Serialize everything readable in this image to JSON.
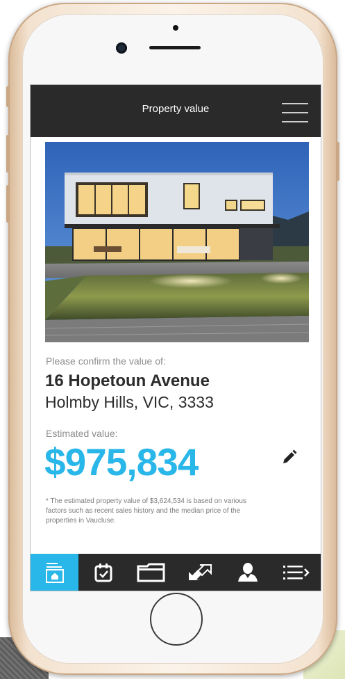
{
  "header": {
    "title": "Property value",
    "menu_icon": "hamburger-icon"
  },
  "property": {
    "confirm_label": "Please confirm the value of:",
    "street": "16 Hopetoun Avenue",
    "suburb_line": "Holmby Hills, VIC, 3333",
    "estimated_label": "Estimated value:",
    "estimated_value": "$975,834",
    "disclaimer": "* The estimated property value of $3,624,534 is based on various factors such as recent sales history and the median price of the properties in Vaucluse."
  },
  "bottom_nav": {
    "items": [
      {
        "icon": "home-icon",
        "active": true
      },
      {
        "icon": "calendar-check-icon",
        "active": false
      },
      {
        "icon": "folder-icon",
        "active": false
      },
      {
        "icon": "transfer-arrows-icon",
        "active": false
      },
      {
        "icon": "user-icon",
        "active": false
      },
      {
        "icon": "list-more-icon",
        "active": false
      }
    ]
  },
  "colors": {
    "accent": "#29b6e8",
    "header_bg": "#2a2a2a",
    "text_dark": "#2c2c2c",
    "text_muted": "#8c8c8c"
  }
}
